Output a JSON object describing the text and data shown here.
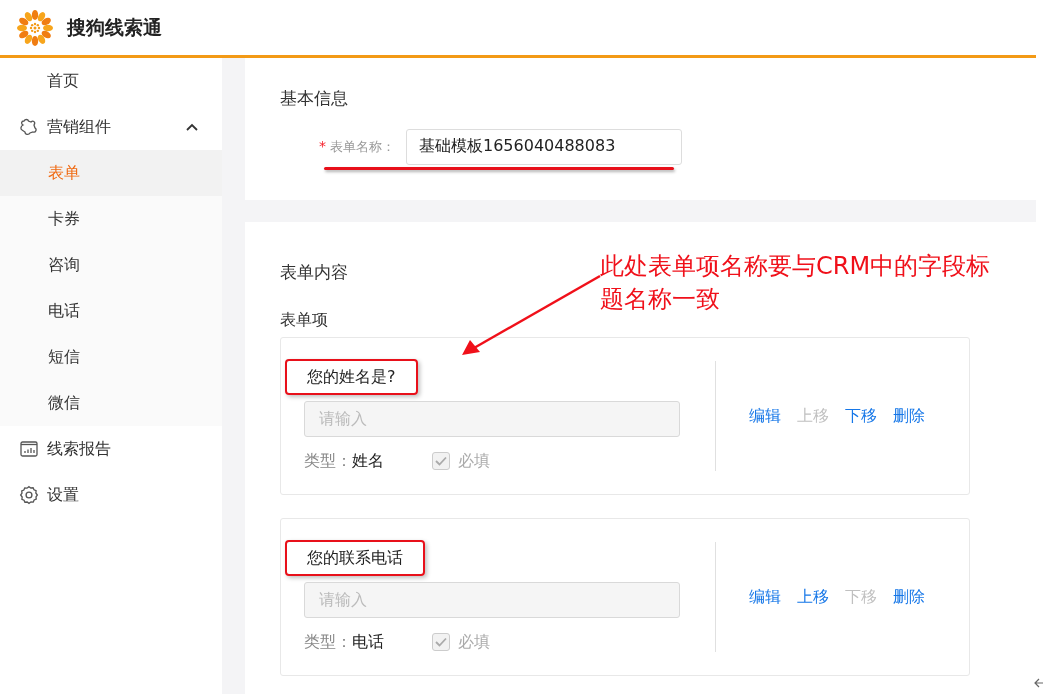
{
  "header": {
    "app_name": "搜狗线索通"
  },
  "sidebar": {
    "items": [
      {
        "label": "首页",
        "selected": false
      },
      {
        "label": "营销组件",
        "selected": false,
        "expanded": true,
        "children": [
          {
            "label": "表单",
            "selected": true
          },
          {
            "label": "卡券",
            "selected": false
          },
          {
            "label": "咨询",
            "selected": false
          },
          {
            "label": "电话",
            "selected": false
          },
          {
            "label": "短信",
            "selected": false
          },
          {
            "label": "微信",
            "selected": false
          }
        ]
      },
      {
        "label": "线索报告",
        "selected": false
      },
      {
        "label": "设置",
        "selected": false
      }
    ]
  },
  "basic_info": {
    "title": "基本信息",
    "field": {
      "required_mark": "*",
      "label": "表单名称：",
      "value": "基础模板1656040488083"
    }
  },
  "form_content": {
    "title": "表单内容",
    "items_label": "表单项",
    "items": [
      {
        "label": "您的姓名是?",
        "placeholder": "请输入",
        "type_label": "类型：",
        "type_value": "姓名",
        "required_checked": true,
        "required_label": "必填",
        "actions": [
          {
            "label": "编辑",
            "disabled": false
          },
          {
            "label": "上移",
            "disabled": true
          },
          {
            "label": "下移",
            "disabled": false
          },
          {
            "label": "删除",
            "disabled": false
          }
        ]
      },
      {
        "label": "您的联系电话",
        "placeholder": "请输入",
        "type_label": "类型：",
        "type_value": "电话",
        "required_checked": true,
        "required_label": "必填",
        "actions": [
          {
            "label": "编辑",
            "disabled": false
          },
          {
            "label": "上移",
            "disabled": false
          },
          {
            "label": "下移",
            "disabled": true
          },
          {
            "label": "删除",
            "disabled": false
          }
        ]
      }
    ]
  },
  "annotation": {
    "text": "此处表单项名称要与CRM中的字段标题名称一致"
  }
}
